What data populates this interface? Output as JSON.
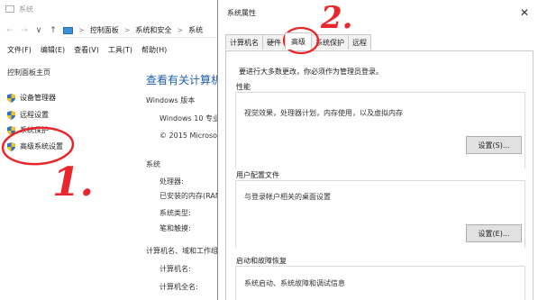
{
  "background_window": {
    "title": "系统",
    "nav": {
      "back": "←",
      "forward": "→",
      "dropdown": "∨",
      "up": "↑"
    },
    "breadcrumb": [
      "控制面板",
      "系统和安全",
      "系统"
    ],
    "breadcrumb_sep": ">",
    "menu": [
      "文件(F)",
      "编辑(E)",
      "查看(V)",
      "工具(T)",
      "帮助(H)"
    ],
    "sidebar": {
      "home": "控制面板主页",
      "items": [
        "设备管理器",
        "远程设置",
        "系统保护",
        "高级系统设置"
      ]
    },
    "main": {
      "heading": "查看有关计算机",
      "windows_edition_label": "Windows 版本",
      "windows_name": "Windows 10 专业",
      "copyright": "© 2015 Microso",
      "system_section": "系统",
      "system_rows": [
        "处理器:",
        "已安装的内存(RAM",
        "系统类型:",
        "笔和触摸:"
      ],
      "computer_section": "计算机名、域和工作组",
      "computer_rows": [
        "计算机名:",
        "计算机全名:"
      ]
    }
  },
  "dialog": {
    "title": "系统属性",
    "close": "✕",
    "tabs": [
      "计算机名",
      "硬件",
      "高级",
      "系统保护",
      "远程"
    ],
    "active_tab_index": 2,
    "intro": "要进行大多数更改，你必须作为管理员登录。",
    "groups": [
      {
        "title": "性能",
        "desc": "视觉效果，处理器计划，内存使用，以及虚拟内存",
        "button": "设置(S)..."
      },
      {
        "title": "用户配置文件",
        "desc": "与登录帐户相关的桌面设置",
        "button": "设置(E)..."
      },
      {
        "title": "启动和故障恢复",
        "desc": "系统启动、系统故障和调试信息"
      }
    ]
  },
  "annotations": {
    "step1": "1.",
    "step2": "2.",
    "color": "#e8262b"
  },
  "colors": {
    "link_blue": "#1e5fa8",
    "shield_blue": "#2f6fc8",
    "shield_yellow": "#f2c318"
  }
}
